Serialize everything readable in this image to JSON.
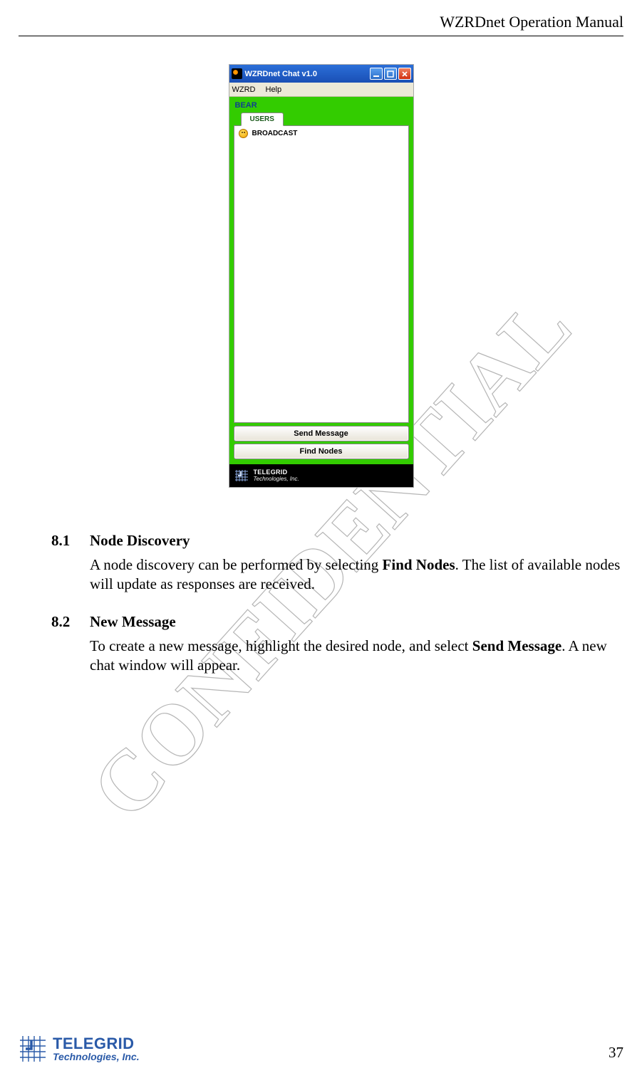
{
  "header": {
    "title": "WZRDnet Operation Manual"
  },
  "watermark_text": "CONFIDENTIAL",
  "screenshot": {
    "window_title": "WZRDnet Chat v1.0",
    "menubar": {
      "items": [
        "WZRD",
        "Help"
      ]
    },
    "user_label": "BEAR",
    "tab_label": "USERS",
    "list_items": [
      "BROADCAST"
    ],
    "buttons": {
      "send": "Send Message",
      "find": "Find Nodes"
    },
    "status": {
      "brand": "TELEGRID",
      "sub": "Technologies, Inc."
    }
  },
  "sections": {
    "s81": {
      "num": "8.1",
      "title": "Node Discovery",
      "para_pre": "A node discovery can be performed by selecting ",
      "para_bold": "Find Nodes",
      "para_post": ".  The list of available nodes will update as responses are received."
    },
    "s82": {
      "num": "8.2",
      "title": "New Message",
      "para_pre": "To create a new message, highlight the desired node, and select ",
      "para_bold": "Send Message",
      "para_post": ".  A new chat window will appear."
    }
  },
  "footer": {
    "brand": "TELEGRID",
    "sub": "Technologies, Inc."
  },
  "page_number": "37"
}
